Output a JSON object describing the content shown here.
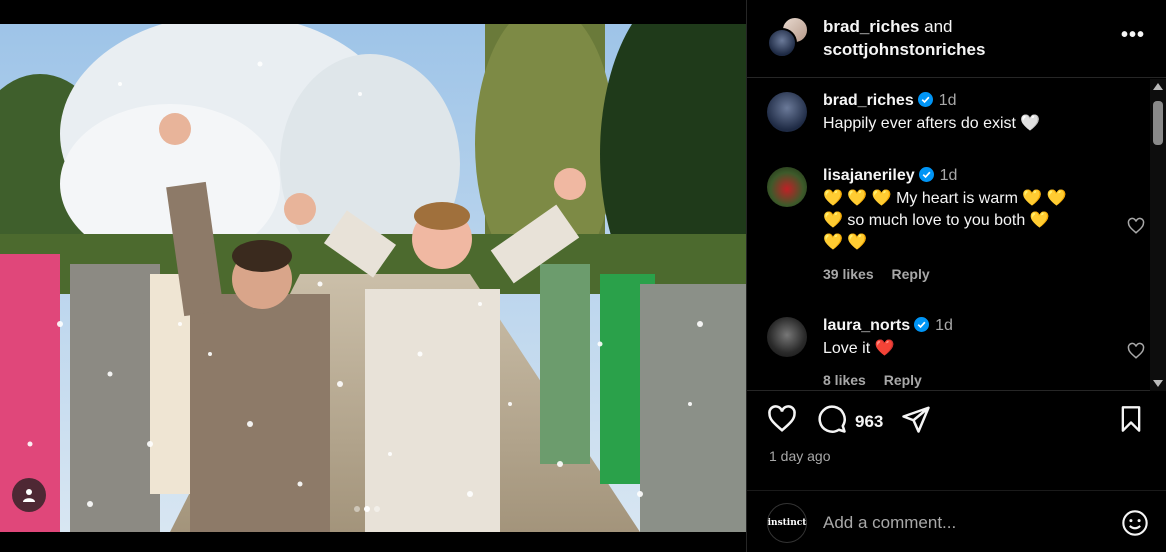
{
  "post": {
    "carousel": {
      "count": 3,
      "active": 1
    }
  },
  "header": {
    "user1": "brad_riches",
    "conjunction": "and",
    "user2": "scottjohnstonriches",
    "more": "•••"
  },
  "comments": [
    {
      "user": "brad_riches",
      "verified": true,
      "time": "1d",
      "text": "Happily ever afters do exist 🤍"
    },
    {
      "user": "lisajaneriley",
      "verified": true,
      "time": "1d",
      "text_lines": [
        "💛 💛 💛 My heart is warm 💛 💛",
        "💛 so much love to you both 💛",
        "💛 💛"
      ],
      "likes": "39 likes",
      "reply": "Reply"
    },
    {
      "user": "laura_norts",
      "verified": true,
      "time": "1d",
      "text": "Love it ❤️",
      "likes": "8 likes",
      "reply": "Reply"
    }
  ],
  "actions": {
    "comment_count": "963",
    "time_ago": "1 day ago"
  },
  "add_comment": {
    "placeholder": "Add a comment...",
    "avatar_text": "instinct"
  },
  "colors": {
    "background": "#000000",
    "text": "#f5f5f5",
    "muted": "#a8a8a8",
    "verified": "#0095f6",
    "heart": "#ff3b6b"
  }
}
